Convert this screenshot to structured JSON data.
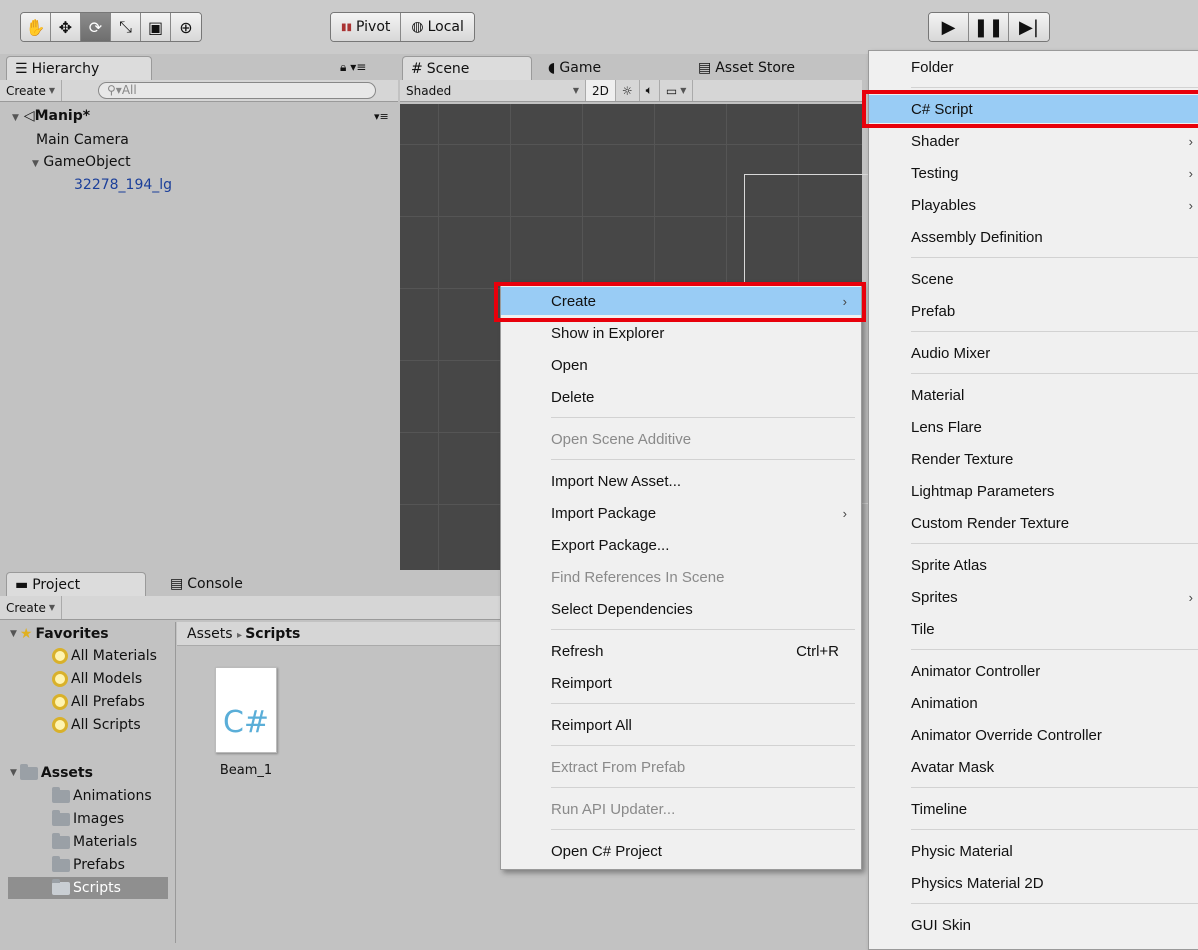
{
  "toolbar": {
    "tools": [
      "hand",
      "move",
      "rotate",
      "scale",
      "rect",
      "transform"
    ],
    "pivot": "Pivot",
    "local": "Local",
    "play": [
      "play",
      "pause",
      "step"
    ]
  },
  "hierarchy": {
    "tab": "Hierarchy",
    "create": "Create",
    "search_placeholder": "All",
    "scene": "Manip*",
    "items": [
      "Main Camera",
      "GameObject",
      "32278_194_lg"
    ]
  },
  "scene_tabs": {
    "scene": "Scene",
    "game": "Game",
    "asset_store": "Asset Store"
  },
  "scene_toolbar": {
    "shading": "Shaded",
    "mode2d": "2D"
  },
  "project": {
    "tab": "Project",
    "console_tab": "Console",
    "create": "Create",
    "favorites": "Favorites",
    "favorites_items": [
      "All Materials",
      "All Models",
      "All Prefabs",
      "All Scripts"
    ],
    "assets": "Assets",
    "asset_folders": [
      "Animations",
      "Images",
      "Materials",
      "Prefabs",
      "Scripts"
    ],
    "breadcrumb_root": "Assets",
    "breadcrumb_current": "Scripts",
    "file_name": "Beam_1",
    "file_glyph": "C#"
  },
  "context_menu": {
    "items": [
      {
        "label": "Create",
        "arrow": true,
        "highlighted": true
      },
      {
        "label": "Show in Explorer"
      },
      {
        "label": "Open"
      },
      {
        "label": "Delete"
      },
      {
        "label": "Open Scene Additive",
        "disabled": true
      },
      {
        "label": "Import New Asset..."
      },
      {
        "label": "Import Package",
        "arrow": true
      },
      {
        "label": "Export Package..."
      },
      {
        "label": "Find References In Scene",
        "disabled": true
      },
      {
        "label": "Select Dependencies"
      },
      {
        "label": "Refresh",
        "shortcut": "Ctrl+R"
      },
      {
        "label": "Reimport"
      },
      {
        "label": "Reimport All"
      },
      {
        "label": "Extract From Prefab",
        "disabled": true
      },
      {
        "label": "Run API Updater...",
        "disabled": true
      },
      {
        "label": "Open C# Project"
      }
    ]
  },
  "create_submenu": {
    "items": [
      {
        "label": "Folder"
      },
      {
        "label": "C# Script",
        "highlighted": true
      },
      {
        "label": "Shader",
        "arrow": true
      },
      {
        "label": "Testing",
        "arrow": true
      },
      {
        "label": "Playables",
        "arrow": true
      },
      {
        "label": "Assembly Definition"
      },
      {
        "label": "Scene"
      },
      {
        "label": "Prefab"
      },
      {
        "label": "Audio Mixer"
      },
      {
        "label": "Material"
      },
      {
        "label": "Lens Flare"
      },
      {
        "label": "Render Texture"
      },
      {
        "label": "Lightmap Parameters"
      },
      {
        "label": "Custom Render Texture"
      },
      {
        "label": "Sprite Atlas"
      },
      {
        "label": "Sprites",
        "arrow": true
      },
      {
        "label": "Tile"
      },
      {
        "label": "Animator Controller"
      },
      {
        "label": "Animation"
      },
      {
        "label": "Animator Override Controller"
      },
      {
        "label": "Avatar Mask"
      },
      {
        "label": "Timeline"
      },
      {
        "label": "Physic Material"
      },
      {
        "label": "Physics Material 2D"
      },
      {
        "label": "GUI Skin"
      }
    ]
  },
  "colors": {
    "highlight": "#99ccf5",
    "annotation_red": "#e8000b",
    "scene_bg": "#474747"
  }
}
